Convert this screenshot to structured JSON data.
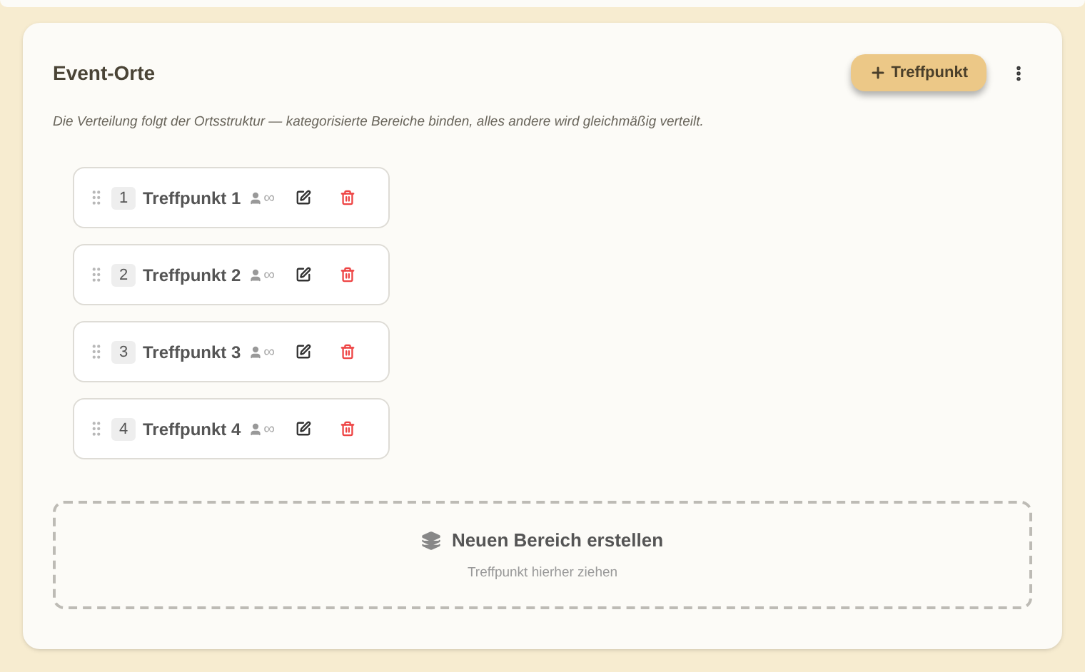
{
  "section": {
    "title": "Event-Orte",
    "add_button": "Treffpunkt",
    "description": "Die Verteilung folgt der Ortsstruktur — kategorisierte Bereiche binden, alles andere wird gleichmäßig verteilt."
  },
  "meeting_points": [
    {
      "number": "1",
      "name": "Treffpunkt 1",
      "capacity": "∞"
    },
    {
      "number": "2",
      "name": "Treffpunkt 2",
      "capacity": "∞"
    },
    {
      "number": "3",
      "name": "Treffpunkt 3",
      "capacity": "∞"
    },
    {
      "number": "4",
      "name": "Treffpunkt 4",
      "capacity": "∞"
    }
  ],
  "drop_zone": {
    "title": "Neuen Bereich erstellen",
    "hint": "Treffpunkt hierher ziehen"
  }
}
